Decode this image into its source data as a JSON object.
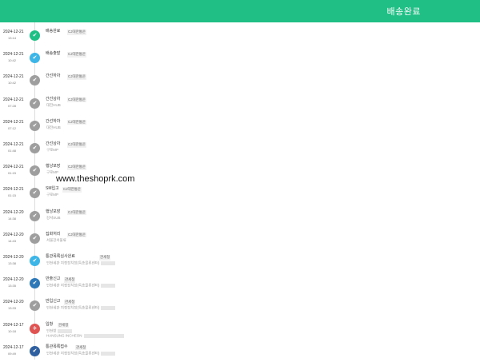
{
  "header": {
    "title": "배송완료",
    "bg": "#1fbf85"
  },
  "watermark": "www.theshoprk.com",
  "events": [
    {
      "date": "2024-12-21",
      "time": "13:14",
      "status": "배송완료",
      "loc": "CJ대한통운",
      "detail": "",
      "icon": "check-icon",
      "color": "#1fbf85"
    },
    {
      "date": "2024-12-21",
      "time": "10:42",
      "status": "배송출발",
      "loc": "CJ대한통운",
      "detail": "",
      "icon": "check-icon",
      "color": "#3db5e6"
    },
    {
      "date": "2024-12-21",
      "time": "10:42",
      "status": "간선하차",
      "loc": "CJ대한통운",
      "detail": "",
      "icon": "check-icon",
      "color": "#9e9e9e"
    },
    {
      "date": "2024-12-21",
      "time": "07:28",
      "status": "간선상차",
      "loc": "CJ대한통운",
      "detail": "대전HUB",
      "icon": "check-icon",
      "color": "#9e9e9e"
    },
    {
      "date": "2024-12-21",
      "time": "07:12",
      "status": "간선하차",
      "loc": "CJ대한통운",
      "detail": "대전HUB",
      "icon": "check-icon",
      "color": "#9e9e9e"
    },
    {
      "date": "2024-12-21",
      "time": "01:48",
      "status": "간선상차",
      "loc": "CJ대한통운",
      "detail": "구로MP",
      "icon": "check-icon",
      "color": "#9e9e9e"
    },
    {
      "date": "2024-12-21",
      "time": "01:15",
      "status": "행낭포장",
      "loc": "CJ대한통운",
      "detail": "구로MP",
      "icon": "check-icon",
      "color": "#9e9e9e"
    },
    {
      "date": "2024-12-21",
      "time": "01:15",
      "status": "SM입고",
      "loc": "CJ대한통운",
      "detail": "구로MP",
      "icon": "check-icon",
      "color": "#9e9e9e"
    },
    {
      "date": "2024-12-20",
      "time": "14:38",
      "status": "행낭포장",
      "loc": "CJ대한통운",
      "detail": "강서SUB",
      "icon": "check-icon",
      "color": "#9e9e9e"
    },
    {
      "date": "2024-12-20",
      "time": "14:43",
      "status": "집화처리",
      "loc": "CJ대한통운",
      "detail": "서울강서물류",
      "icon": "check-icon",
      "color": "#9e9e9e"
    },
    {
      "date": "2024-12-20",
      "time": "13:38",
      "status": "통관목록심사완료",
      "loc": "관세청",
      "detail": "인천세관 지정장치장(특송물류센터)",
      "icon": "check-icon",
      "color": "#3db5e6"
    },
    {
      "date": "2024-12-20",
      "time": "13:35",
      "status": "반출신고",
      "loc": "관세청",
      "detail": "인천세관 지정장치장(특송물류센터)",
      "icon": "check-icon",
      "color": "#2f78b7"
    },
    {
      "date": "2024-12-20",
      "time": "13:33",
      "status": "반입신고",
      "loc": "관세청",
      "detail": "인천세관 지정장치장(특송물류센터)",
      "icon": "check-icon",
      "color": "#9e9e9e"
    },
    {
      "date": "2024-12-17",
      "time": "10:18",
      "status": "입항",
      "loc": "관세청",
      "detail": "인천항",
      "detail2": "HANSUNG INCHEON",
      "icon": "plane-icon",
      "color": "#e05353"
    },
    {
      "date": "2024-12-17",
      "time": "09:49",
      "status": "통관목록접수",
      "loc": "관세청",
      "detail": "인천세관 지정장치장(특송물류센터)",
      "icon": "check-icon",
      "color": "#2f5f9e"
    }
  ]
}
